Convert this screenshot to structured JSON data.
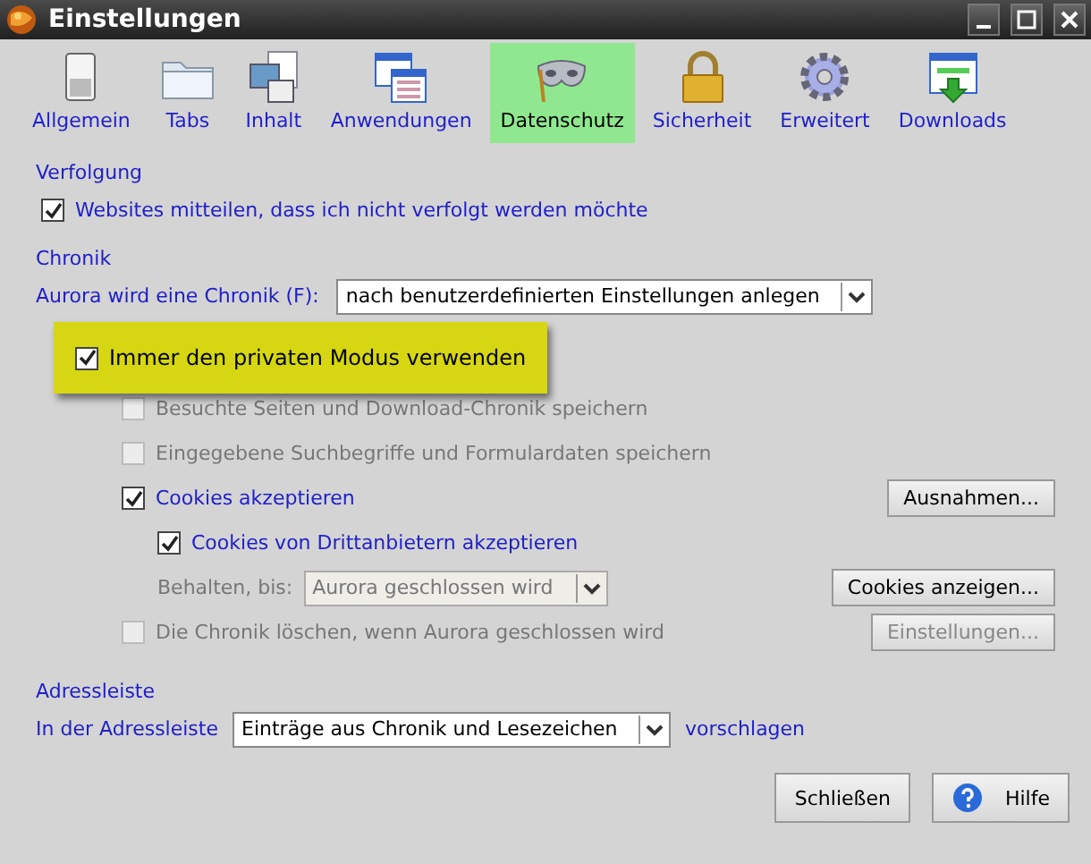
{
  "window": {
    "title": "Einstellungen"
  },
  "tabs": [
    {
      "label": "Allgemein",
      "selected": false
    },
    {
      "label": "Tabs",
      "selected": false
    },
    {
      "label": "Inhalt",
      "selected": false
    },
    {
      "label": "Anwendungen",
      "selected": false
    },
    {
      "label": "Datenschutz",
      "selected": true
    },
    {
      "label": "Sicherheit",
      "selected": false
    },
    {
      "label": "Erweitert",
      "selected": false
    },
    {
      "label": "Downloads",
      "selected": false
    }
  ],
  "tracking": {
    "heading": "Verfolgung",
    "option": {
      "label": "Websites mitteilen, dass ich nicht verfolgt werden möchte",
      "checked": true
    }
  },
  "history": {
    "heading": "Chronik",
    "mode_label": "Aurora wird eine Chronik (F):",
    "mode_value": "nach benutzerdefinierten Einstellungen anlegen",
    "private_mode": {
      "label": "Immer den privaten Modus verwenden",
      "checked": true
    },
    "options": [
      {
        "kind": "checkbox",
        "label": "Besuchte Seiten und Download-Chronik speichern",
        "checked": false,
        "disabled": true
      },
      {
        "kind": "checkbox",
        "label": "Eingegebene Suchbegriffe und Formulardaten speichern",
        "checked": false,
        "disabled": true
      },
      {
        "kind": "checkbox",
        "label": "Cookies akzeptieren",
        "checked": true,
        "disabled": false,
        "button": {
          "label": "Ausnahmen...",
          "disabled": false
        },
        "children": [
          {
            "kind": "checkbox",
            "label": "Cookies von Drittanbietern akzeptieren",
            "checked": true,
            "disabled": false
          },
          {
            "kind": "select",
            "label": "Behalten, bis:",
            "value": "Aurora geschlossen wird",
            "disabled": true,
            "button": {
              "label": "Cookies anzeigen...",
              "disabled": false
            }
          }
        ]
      },
      {
        "kind": "checkbox",
        "label": "Die Chronik löschen, wenn Aurora geschlossen wird",
        "checked": false,
        "disabled": true,
        "button": {
          "label": "Einstellungen...",
          "disabled": true
        }
      }
    ]
  },
  "address_bar": {
    "heading": "Adressleiste",
    "label": "In der Adressleiste",
    "value": "Einträge aus Chronik und Lesezeichen",
    "suffix": "vorschlagen"
  },
  "buttons": [
    {
      "kind": "plain",
      "label": "Schließen"
    },
    {
      "kind": "help",
      "label": "Hilfe"
    }
  ]
}
